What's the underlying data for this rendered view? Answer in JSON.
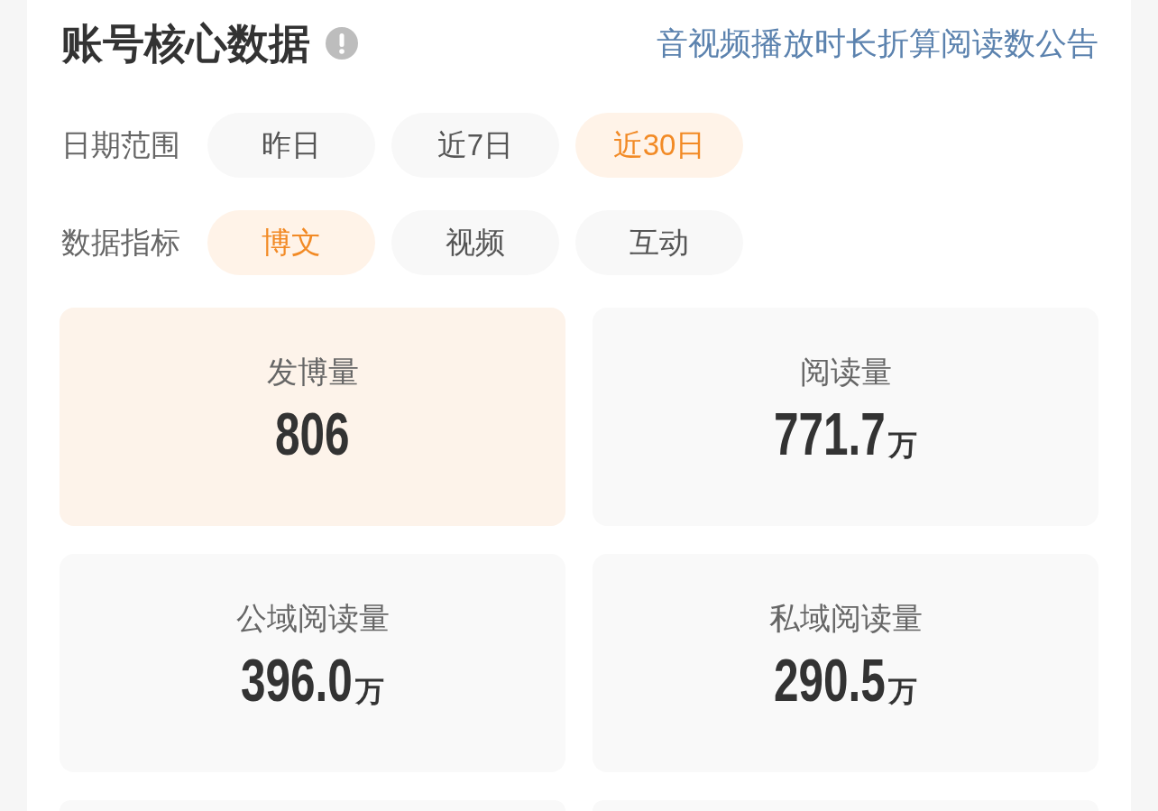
{
  "header": {
    "title": "账号核心数据",
    "link": "音视频播放时长折算阅读数公告"
  },
  "filters": [
    {
      "label": "日期范围",
      "options": [
        {
          "label": "昨日",
          "selected": false
        },
        {
          "label": "近7日",
          "selected": false
        },
        {
          "label": "近30日",
          "selected": true
        }
      ]
    },
    {
      "label": "数据指标",
      "options": [
        {
          "label": "博文",
          "selected": true
        },
        {
          "label": "视频",
          "selected": false
        },
        {
          "label": "互动",
          "selected": false
        }
      ]
    }
  ],
  "stats": [
    {
      "label": "发博量",
      "value": "806",
      "selected": true
    },
    {
      "label": "阅读量",
      "value": "771.7",
      "unit": "万",
      "selected": false
    },
    {
      "label": "公域阅读量",
      "value": "396.0",
      "unit": "万",
      "selected": false
    },
    {
      "label": "私域阅读量",
      "value": "290.5",
      "unit": "万",
      "selected": false
    }
  ]
}
